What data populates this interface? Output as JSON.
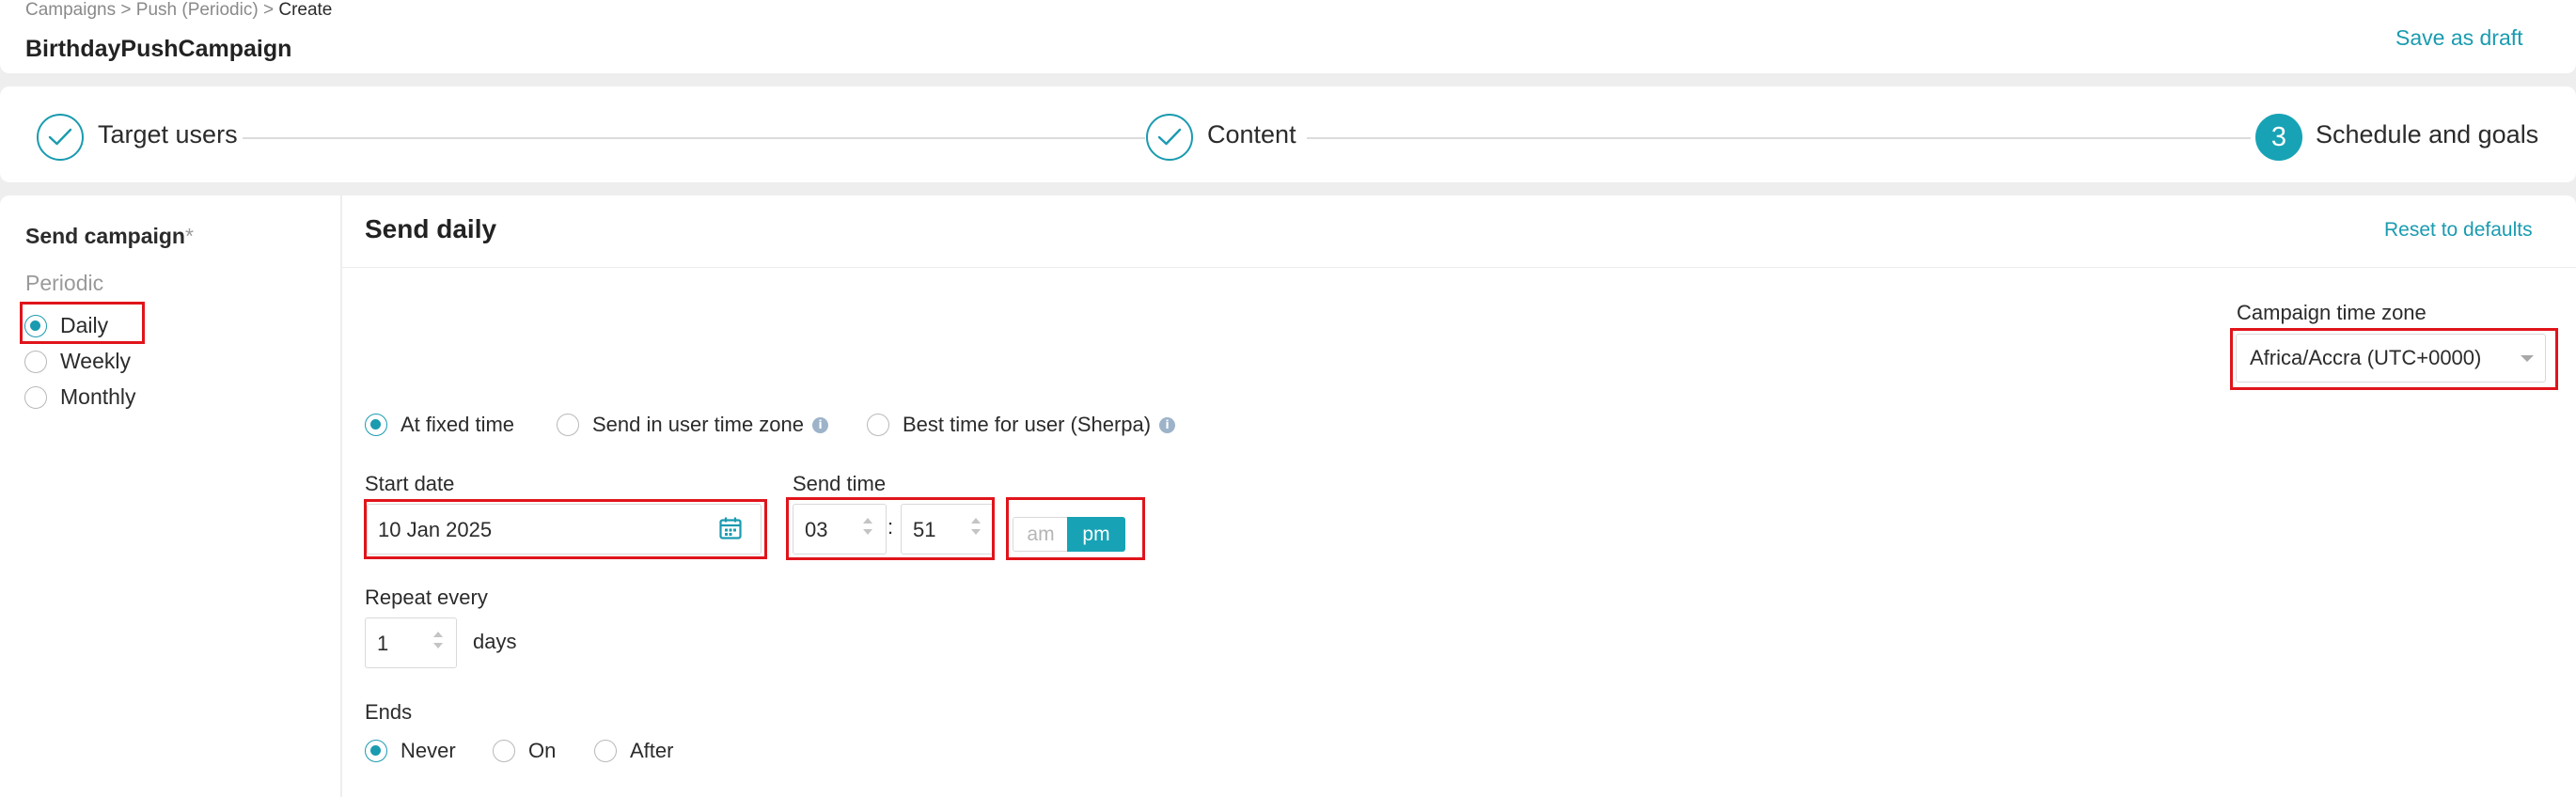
{
  "breadcrumb": {
    "items": [
      "Campaigns",
      "Push (Periodic)",
      "Create"
    ],
    "separator": ">"
  },
  "header": {
    "title": "BirthdayPushCampaign",
    "save_draft": "Save as draft"
  },
  "stepper": {
    "steps": [
      {
        "label": "Target users",
        "state": "done"
      },
      {
        "label": "Content",
        "state": "done"
      },
      {
        "label": "Schedule and goals",
        "state": "active",
        "number": "3"
      }
    ]
  },
  "send_campaign": {
    "title": "Send campaign",
    "required_mark": "*",
    "group_label": "Periodic",
    "options": [
      {
        "label": "Daily",
        "selected": true
      },
      {
        "label": "Weekly",
        "selected": false
      },
      {
        "label": "Monthly",
        "selected": false
      }
    ]
  },
  "main": {
    "title": "Send daily",
    "reset": "Reset to defaults"
  },
  "timezone": {
    "label": "Campaign time zone",
    "value": "Africa/Accra (UTC+0000)"
  },
  "send_mode": {
    "options": [
      {
        "label": "At fixed time",
        "selected": true,
        "info": false
      },
      {
        "label": "Send in user time zone",
        "selected": false,
        "info": true
      },
      {
        "label": "Best time for user (Sherpa)",
        "selected": false,
        "info": true
      }
    ]
  },
  "start_date": {
    "label": "Start date",
    "value": "10 Jan 2025"
  },
  "send_time": {
    "label": "Send time",
    "hour": "03",
    "separator": ":",
    "minute": "51",
    "am_label": "am",
    "pm_label": "pm",
    "selected_period": "pm"
  },
  "repeat": {
    "label": "Repeat every",
    "value": "1",
    "unit": "days"
  },
  "ends": {
    "label": "Ends",
    "options": [
      {
        "label": "Never",
        "selected": true
      },
      {
        "label": "On",
        "selected": false
      },
      {
        "label": "After",
        "selected": false
      }
    ]
  },
  "colors": {
    "accent": "#1a9bb0",
    "highlight": "#e0141b"
  }
}
